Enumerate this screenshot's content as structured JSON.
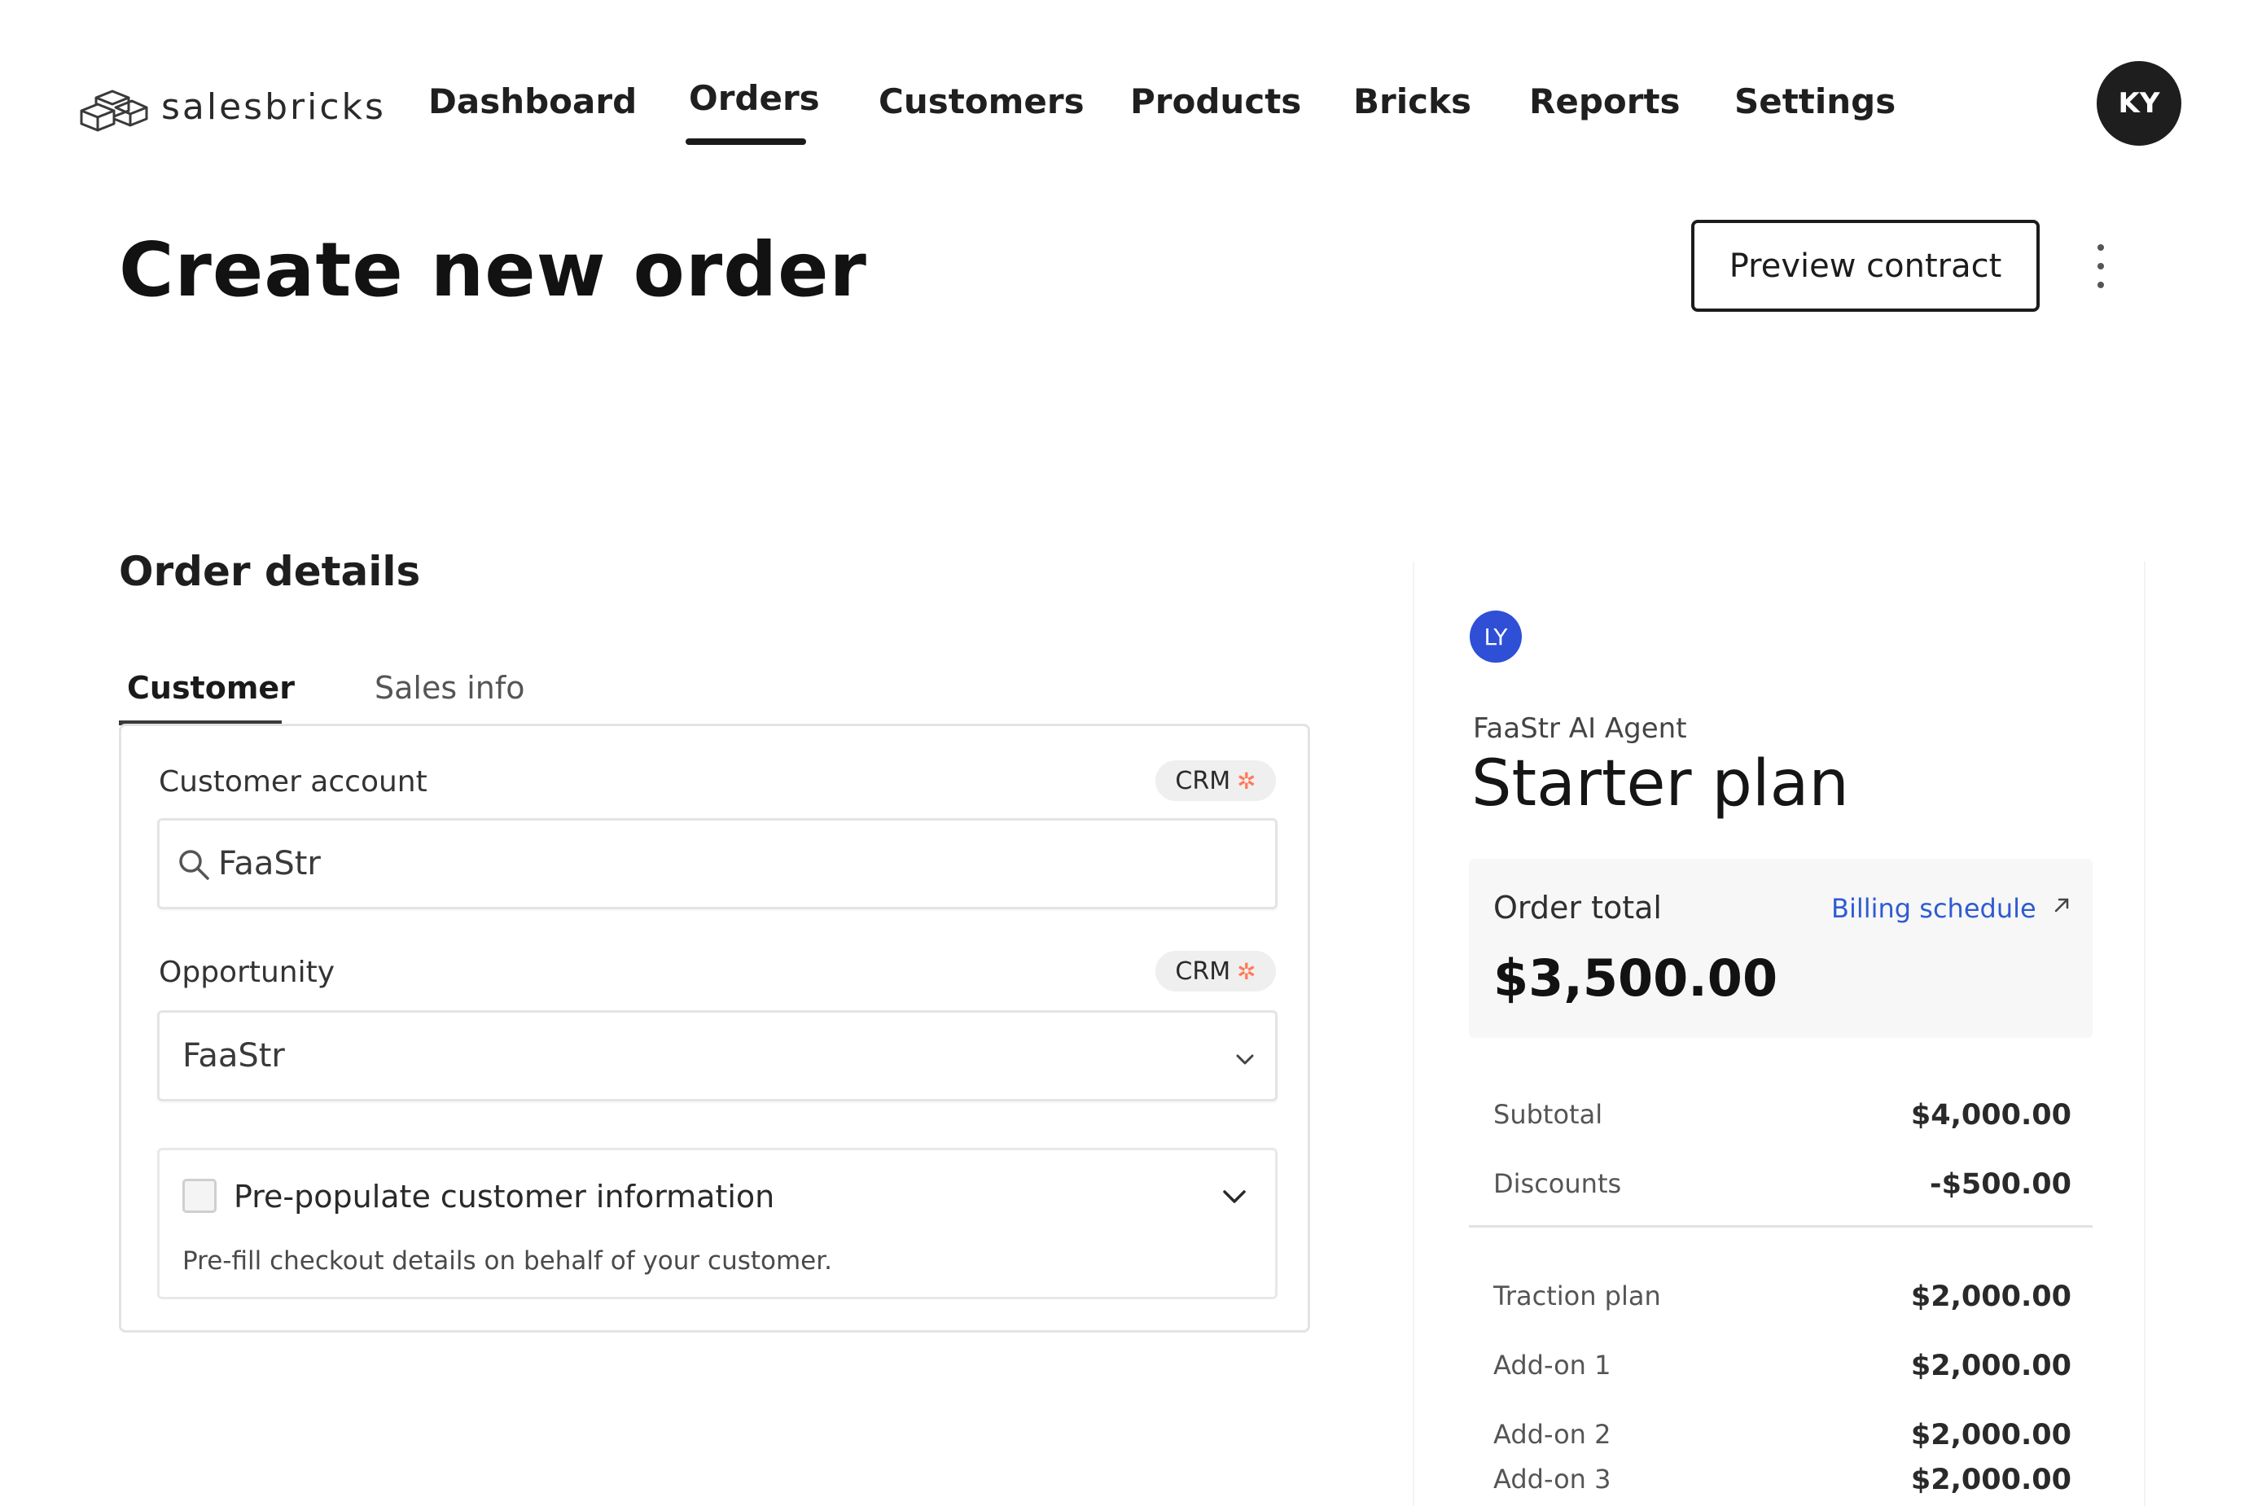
{
  "nav": {
    "brand": "salesbricks",
    "items": [
      {
        "label": "Dashboard"
      },
      {
        "label": "Orders"
      },
      {
        "label": "Customers"
      },
      {
        "label": "Products"
      },
      {
        "label": "Bricks"
      },
      {
        "label": "Reports"
      },
      {
        "label": "Settings"
      }
    ],
    "active": "Orders",
    "user_initials": "KY"
  },
  "header": {
    "title": "Create new order",
    "preview_button": "Preview contract",
    "more_icon": "kebab-menu-icon"
  },
  "order_details": {
    "title": "Order details",
    "tabs": [
      {
        "label": "Customer"
      },
      {
        "label": "Sales info"
      }
    ],
    "active_tab": "Customer",
    "customer_account": {
      "label": "Customer account",
      "badge": "CRM",
      "value": "FaaStr",
      "icon": "search-icon"
    },
    "opportunity": {
      "label": "Opportunity",
      "badge": "CRM",
      "value": "FaaStr",
      "icon": "chevron-down-icon"
    },
    "prepopulate": {
      "checked": false,
      "title": "Pre-populate customer information",
      "description": "Pre-fill checkout details on behalf of your customer."
    }
  },
  "summary": {
    "avatar_initials": "LY",
    "product": "FaaStr AI Agent",
    "plan": "Starter plan",
    "order_total_label": "Order total",
    "billing_link": "Billing schedule",
    "order_total": "$3,500.00",
    "lines_top": [
      {
        "label": "Subtotal",
        "value": "$4,000.00"
      },
      {
        "label": "Discounts",
        "value": "-$500.00"
      }
    ],
    "lines_bottom": [
      {
        "label": "Traction plan",
        "value": "$2,000.00"
      },
      {
        "label": "Add-on 1",
        "value": "$2,000.00"
      },
      {
        "label": "Add-on 2",
        "value": "$2,000.00"
      },
      {
        "label": "Add-on 3",
        "value": "$2,000.00"
      }
    ]
  },
  "colors": {
    "accent_link": "#2f5bd3",
    "avatar_ly": "#2e4fd6",
    "hubspot": "#ff7a59",
    "dark": "#1a1a1a"
  }
}
